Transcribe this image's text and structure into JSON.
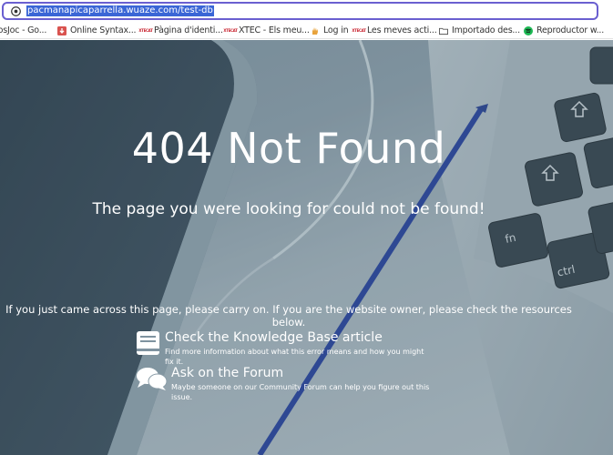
{
  "browser": {
    "url": "pacmanapicaparrella.wuaze.com/test-db",
    "bookmarks": [
      {
        "label": "eosJoc - Go...",
        "icon": "partial-icon"
      },
      {
        "label": "Online Syntax...",
        "icon": "download-arrow-icon"
      },
      {
        "label": "Pàgina d'identi...",
        "icon": "xtec-badge-icon"
      },
      {
        "label": "XTEC - Els meu...",
        "icon": "xtec-badge-icon"
      },
      {
        "label": "Log in",
        "icon": "hand-icon"
      },
      {
        "label": "Les meves acti...",
        "icon": "xtec-badge-icon"
      },
      {
        "label": "Importado des...",
        "icon": "folder-icon"
      },
      {
        "label": "Reproductor w...",
        "icon": "spotify-icon"
      }
    ],
    "badge_text_top": "XTE",
    "badge_text_bottom": "CAT"
  },
  "page": {
    "title": "404 Not Found",
    "subtitle": "The page you were looking for could not be found!",
    "info": "If you just came across this page, please carry on. If you are the website owner, please check the resources below.",
    "resources": [
      {
        "title": "Check the Knowledge Base article",
        "description": "Find more information about what this error means and how you might fix it.",
        "icon": "book-icon"
      },
      {
        "title": "Ask on the Forum",
        "description": "Maybe someone on our Community Forum can help you figure out this issue.",
        "icon": "chat-bubbles-icon"
      }
    ],
    "keyboard_keys": [
      "fn",
      "ctrl"
    ]
  },
  "colors": {
    "url_highlight": "#3a66d6",
    "urlbar_border": "#6a5fd0",
    "overlay_text": "#ffffff",
    "pen_blue": "#1f3a9a",
    "key_dark": "#2e3b45"
  }
}
